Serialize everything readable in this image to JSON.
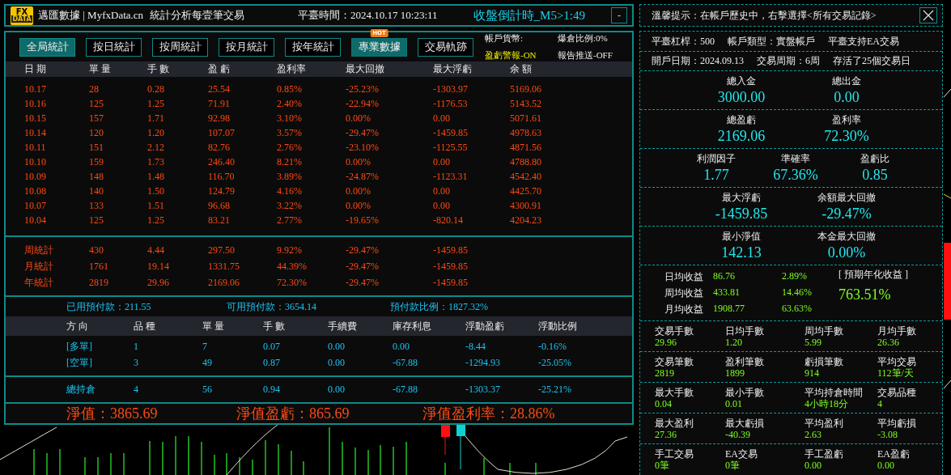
{
  "header": {
    "logo": [
      "FX",
      "DATA"
    ],
    "title": "邁匯數據 | MyfxData.cn",
    "subtitle": "統計分析每壹筆交易",
    "server_time": "平臺時間：2024.10.17 10:23:11",
    "countdown": "收盤倒計時_M5>1:49",
    "minimize": "-"
  },
  "tabs": [
    {
      "label": "全局統計",
      "selected": true,
      "highlighted": false
    },
    {
      "label": "按日統計",
      "selected": false,
      "highlighted": false
    },
    {
      "label": "按周統計",
      "selected": false,
      "highlighted": false
    },
    {
      "label": "按月統計",
      "selected": false,
      "highlighted": false
    },
    {
      "label": "按年統計",
      "selected": false,
      "highlighted": false
    },
    {
      "label": "專業數據",
      "selected": false,
      "highlighted": true,
      "badge": "HOT"
    },
    {
      "label": "交易軌跡",
      "selected": false,
      "highlighted": false
    }
  ],
  "account_flags": [
    {
      "text": "帳戶貨幣:",
      "alert": false
    },
    {
      "text": "爆倉比例:0%",
      "alert": false
    },
    {
      "text": "盈虧警報-ON",
      "alert": true
    },
    {
      "text": "報告推送-OFF",
      "alert": false
    }
  ],
  "daily_table": {
    "columns": [
      "日 期",
      "單 量",
      "手 數",
      "盈 虧",
      "盈利率",
      "最大回撤",
      "最大浮虧",
      "余 額"
    ],
    "rows": [
      [
        "10.17",
        "28",
        "0.28",
        "25.54",
        "0.85%",
        "-25.23%",
        "-1303.97",
        "5169.06"
      ],
      [
        "10.16",
        "125",
        "1.25",
        "71.91",
        "2.40%",
        "-22.94%",
        "-1176.53",
        "5143.52"
      ],
      [
        "10.15",
        "157",
        "1.71",
        "92.98",
        "3.10%",
        "0.00%",
        "0.00",
        "5071.61"
      ],
      [
        "10.14",
        "120",
        "1.20",
        "107.07",
        "3.57%",
        "-29.47%",
        "-1459.85",
        "4978.63"
      ],
      [
        "10.11",
        "151",
        "2.12",
        "82.76",
        "2.76%",
        "-23.10%",
        "-1125.55",
        "4871.56"
      ],
      [
        "10.10",
        "159",
        "1.73",
        "246.40",
        "8.21%",
        "0.00%",
        "0.00",
        "4788.80"
      ],
      [
        "10.09",
        "148",
        "1.48",
        "116.70",
        "3.89%",
        "-24.87%",
        "-1123.31",
        "4542.40"
      ],
      [
        "10.08",
        "140",
        "1.50",
        "124.79",
        "4.16%",
        "0.00%",
        "0.00",
        "4425.70"
      ],
      [
        "10.07",
        "133",
        "1.51",
        "96.68",
        "3.22%",
        "0.00%",
        "0.00",
        "4300.91"
      ],
      [
        "10.04",
        "125",
        "1.25",
        "83.21",
        "2.77%",
        "-19.65%",
        "-820.14",
        "4204.23"
      ]
    ]
  },
  "summary_rows": [
    [
      "周統計",
      "430",
      "4.44",
      "297.50",
      "9.92%",
      "-29.47%",
      "-1459.85"
    ],
    [
      "月統計",
      "1761",
      "19.14",
      "1331.75",
      "44.39%",
      "-29.47%",
      "-1459.85"
    ],
    [
      "年統計",
      "2819",
      "29.96",
      "2169.06",
      "72.30%",
      "-29.47%",
      "-1459.85"
    ]
  ],
  "prepayment": [
    "已用預付款：211.55",
    "可用預付款：3654.14",
    "預付款比例：1827.32%"
  ],
  "positions_table": {
    "columns": [
      "方 向",
      "品 種",
      "單 量",
      "手 數",
      "手續費",
      "庫存利息",
      "浮動盈虧",
      "浮動比例"
    ],
    "rows": [
      [
        "[多單]",
        "1",
        "7",
        "0.07",
        "0.00",
        "0.00",
        "-8.44",
        "-0.16%"
      ],
      [
        "[空單]",
        "3",
        "49",
        "0.87",
        "0.00",
        "-67.88",
        "-1294.93",
        "-25.05%"
      ]
    ],
    "total": [
      "總持倉",
      "4",
      "56",
      "0.94",
      "0.00",
      "-67.88",
      "-1303.37",
      "-25.21%"
    ]
  },
  "equity": [
    "淨值：3865.69",
    "淨值盈虧：865.69",
    "淨值盈利率：28.86%"
  ],
  "tip": "溫馨提示：在帳戶歷史中，右擊選擇<所有交易記錄>",
  "account_details": [
    [
      "平臺杠桿：500",
      "帳戶類型：實盤帳戶",
      "平臺支持EA交易"
    ],
    [
      "開戶日期：2024.09.13",
      "交易周期：6周",
      "存活了25個交易日"
    ]
  ],
  "stat_sections": [
    [
      {
        "label": "總入金",
        "value": "3000.00"
      },
      {
        "label": "總出金",
        "value": "0.00"
      }
    ],
    [
      {
        "label": "總盈虧",
        "value": "2169.06"
      },
      {
        "label": "盈利率",
        "value": "72.30%"
      }
    ],
    [
      {
        "label": "利潤因子",
        "value": "1.77"
      },
      {
        "label": "準確率",
        "value": "67.36%"
      },
      {
        "label": "盈虧比",
        "value": "0.85"
      }
    ],
    [
      {
        "label": "最大浮虧",
        "value": "-1459.85"
      },
      {
        "label": "余額最大回撤",
        "value": "-29.47%"
      }
    ],
    [
      {
        "label": "最小淨值",
        "value": "142.13"
      },
      {
        "label": "本金最大回撤",
        "value": "0.00%"
      }
    ]
  ],
  "returns": {
    "rows": [
      {
        "label": "日均收益",
        "value": "86.76",
        "percent": "2.89%"
      },
      {
        "label": "周均收益",
        "value": "433.81",
        "percent": "14.46%"
      },
      {
        "label": "月均收益",
        "value": "1908.77",
        "percent": "63.63%"
      }
    ],
    "annual_label": "[ 預期年化收益 ]",
    "annual_value": "763.51%"
  },
  "trade_stats": [
    [
      {
        "label": "交易手數",
        "value": "29.96"
      },
      {
        "label": "日均手數",
        "value": "1.20"
      },
      {
        "label": "周均手數",
        "value": "5.99"
      },
      {
        "label": "月均手數",
        "value": "26.36"
      }
    ],
    [
      {
        "label": "交易筆數",
        "value": "2819"
      },
      {
        "label": "盈利筆數",
        "value": "1899"
      },
      {
        "label": "虧損筆數",
        "value": "914"
      },
      {
        "label": "平均交易",
        "value": "112筆/天"
      }
    ],
    [
      {
        "label": "最大手數",
        "value": "0.04"
      },
      {
        "label": "最小手數",
        "value": "0.01"
      },
      {
        "label": "平均持倉時間",
        "value": "4小時18分"
      },
      {
        "label": "交易品種",
        "value": "4"
      }
    ],
    [
      {
        "label": "最大盈利",
        "value": "27.36"
      },
      {
        "label": "最大虧損",
        "value": "-40.39"
      },
      {
        "label": "平均盈利",
        "value": "2.63"
      },
      {
        "label": "平均虧損",
        "value": "-3.08"
      }
    ],
    [
      {
        "label": "手工交易",
        "value": "0筆"
      },
      {
        "label": "EA交易",
        "value": "0筆"
      },
      {
        "label": "手工盈虧",
        "value": "0.00"
      },
      {
        "label": "EA盈虧",
        "value": "0.00"
      }
    ]
  ]
}
